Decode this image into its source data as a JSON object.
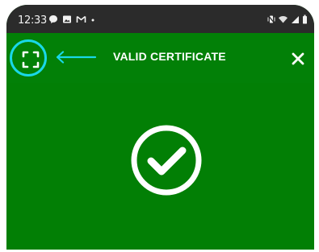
{
  "status_bar": {
    "time": "12:33",
    "left_icons": [
      "chat-icon",
      "image-icon",
      "gmail-icon",
      "dot-icon"
    ],
    "right_icons": [
      "vibrate-mute-icon",
      "wifi-icon",
      "signal-icon",
      "battery-icon"
    ]
  },
  "app_bar": {
    "title": "VALID CERTIFICATE",
    "left_icon": "fullscreen-scan-icon",
    "annotation_icon": "arrow-left-icon",
    "close_icon": "close-icon"
  },
  "result": {
    "icon": "check-circle-icon"
  },
  "colors": {
    "background_green": "#027f05",
    "status_bar": "#2b2b2b",
    "highlight_cyan": "#19d8e8",
    "white": "#ffffff"
  }
}
